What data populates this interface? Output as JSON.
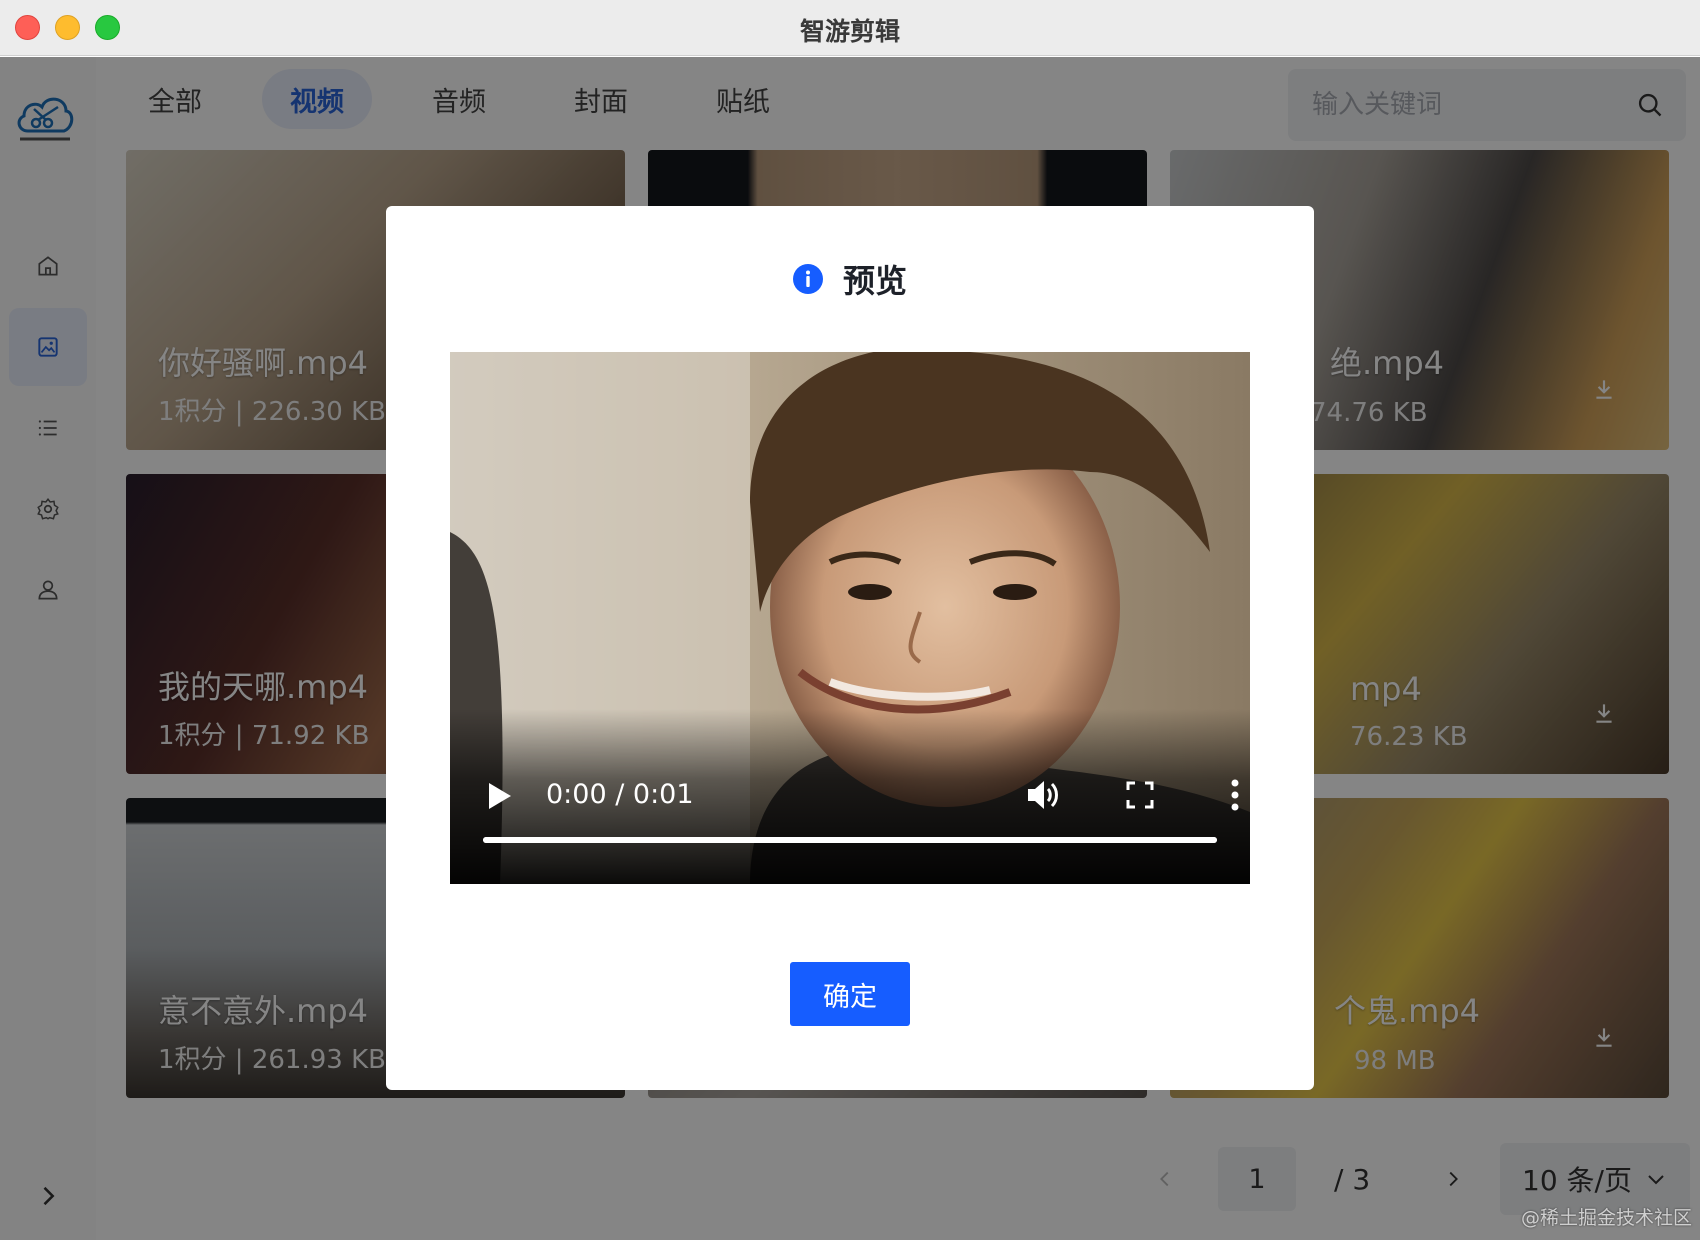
{
  "window": {
    "title": "智游剪辑"
  },
  "sidebar": {
    "items": [
      {
        "icon": "home-icon"
      },
      {
        "icon": "image-icon",
        "active": true
      },
      {
        "icon": "list-icon"
      },
      {
        "icon": "gear-icon"
      },
      {
        "icon": "user-icon"
      }
    ]
  },
  "tabs": [
    {
      "label": "全部"
    },
    {
      "label": "视频",
      "active": true
    },
    {
      "label": "音频"
    },
    {
      "label": "封面"
    },
    {
      "label": "贴纸"
    }
  ],
  "search": {
    "placeholder": "输入关键词"
  },
  "cards": [
    {
      "name": "你好骚啊.mp4",
      "meta": "1积分 | 226.30 KB"
    },
    {
      "name": "",
      "meta": ""
    },
    {
      "name": "绝.mp4",
      "meta": "74.76 KB"
    },
    {
      "name": "我的天哪.mp4",
      "meta": "1积分 | 71.92 KB"
    },
    {
      "name": "",
      "meta": ""
    },
    {
      "name": "mp4",
      "meta": "76.23 KB"
    },
    {
      "name": "意不意外.mp4",
      "meta": "1积分 | 261.93 KB"
    },
    {
      "name": "",
      "meta": ""
    },
    {
      "name": "个鬼.mp4",
      "meta": "98 MB"
    }
  ],
  "pagination": {
    "current": "1",
    "total": "/ 3",
    "page_size": "10 条/页"
  },
  "modal": {
    "title": "预览",
    "player": {
      "time": "0:00 / 0:01",
      "progress": 1.0
    },
    "confirm_label": "确定"
  },
  "watermark": "@稀土掘金技术社区",
  "colors": {
    "primary": "#165dff",
    "active_tab_bg": "#e8eefb"
  }
}
